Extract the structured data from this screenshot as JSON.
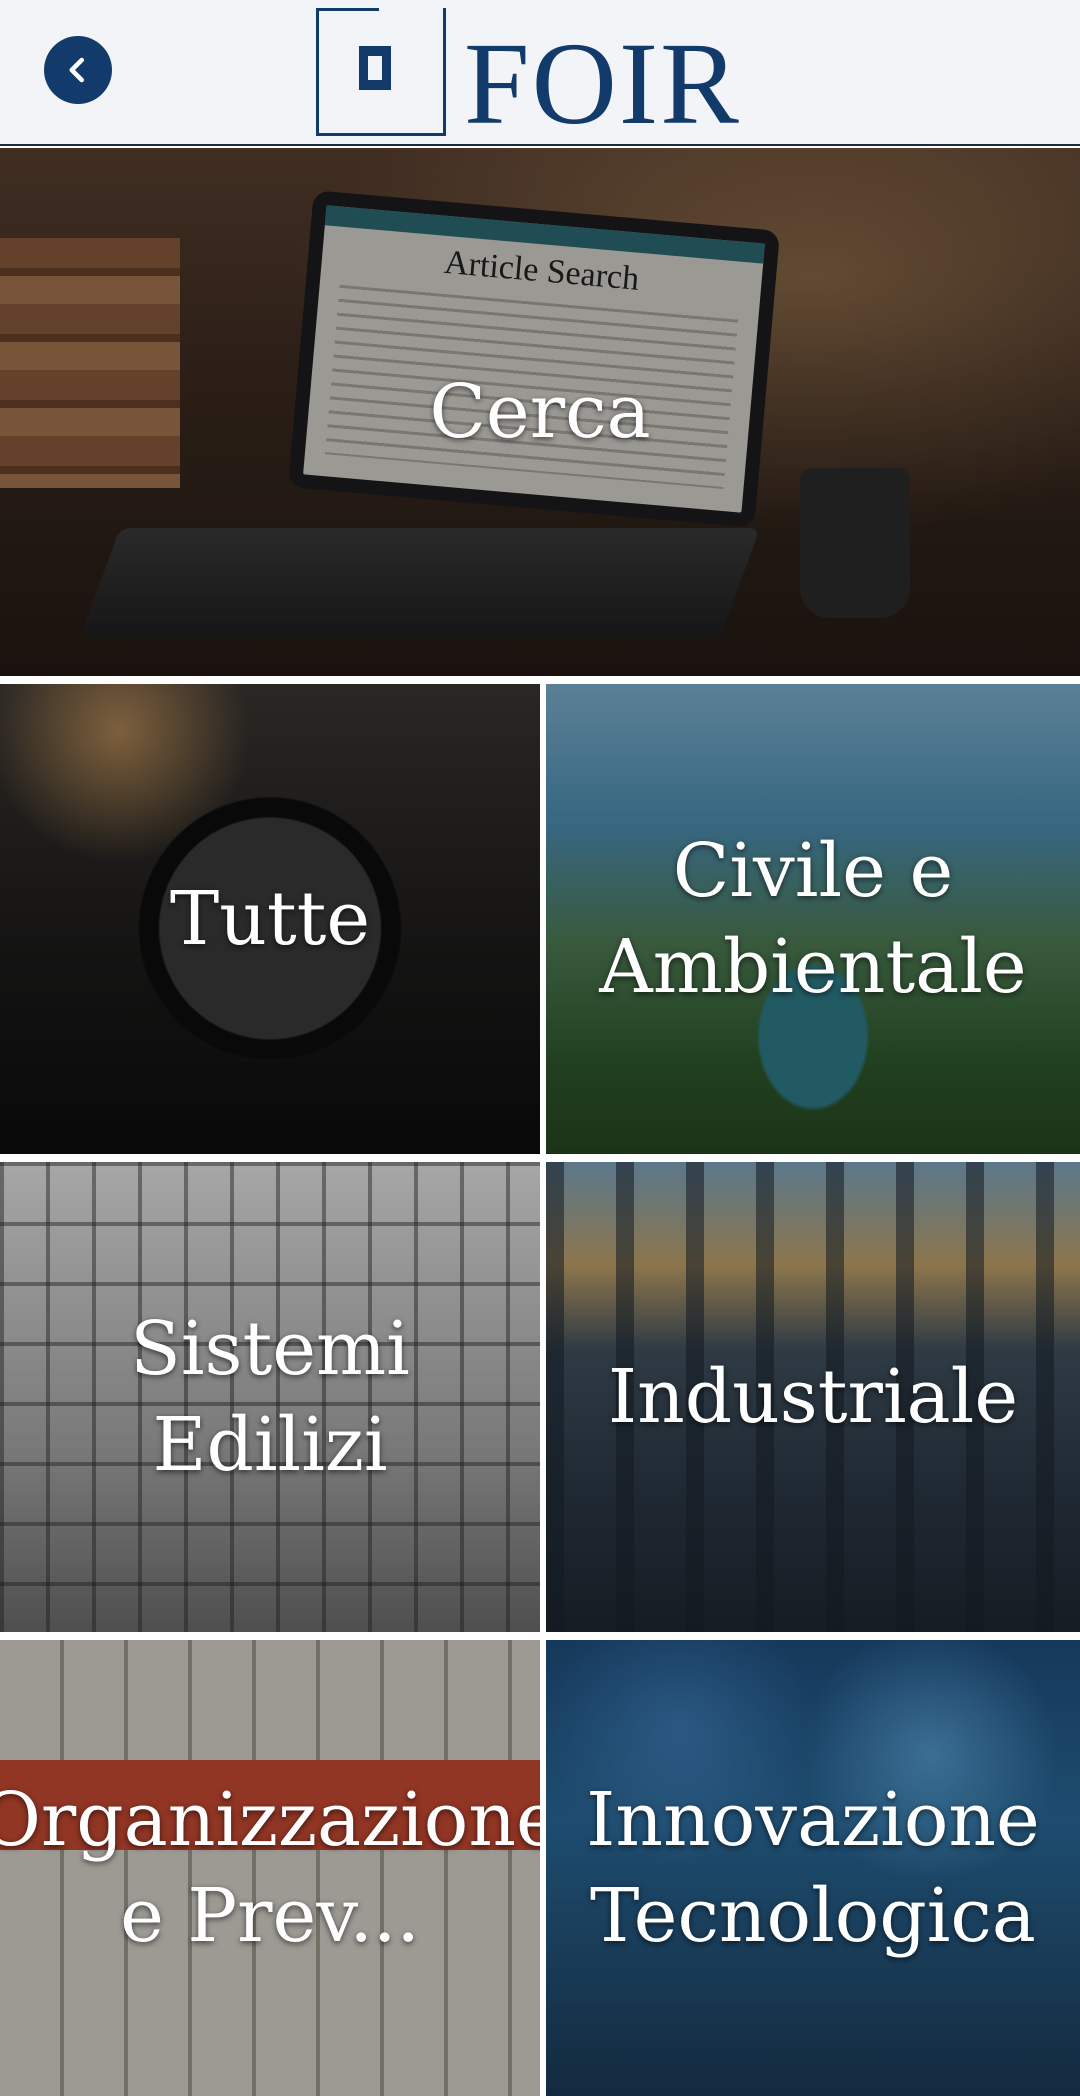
{
  "header": {
    "back_icon": "chevron-left-icon",
    "logo_text": "FOIR",
    "colors": {
      "brand": "#123a6b",
      "background": "#f2f4f7"
    }
  },
  "hero": {
    "label": "Cerca",
    "screen_title": "Article Search"
  },
  "categories": [
    {
      "label": "Tutte"
    },
    {
      "label": "Civile e Ambientale"
    },
    {
      "label": "Sistemi Edilizi"
    },
    {
      "label": "Industriale"
    },
    {
      "label": "Organizzazione e Prev..."
    },
    {
      "label": "Innovazione Tecnologica"
    }
  ]
}
